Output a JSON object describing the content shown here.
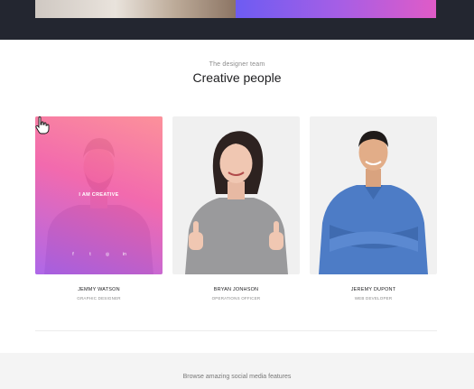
{
  "section": {
    "eyebrow": "The designer team",
    "title": "Creative people"
  },
  "team": [
    {
      "name": "JEMMY WATSON",
      "role": "GRAPHIC DESIGNER"
    },
    {
      "name": "BRYAN JONHSON",
      "role": "OPERATIONS OFFICER"
    },
    {
      "name": "JEREMY DUPONT",
      "role": "WEB DEVELOPER"
    }
  ],
  "hover_card": {
    "label": "I AM CREATIVE",
    "social_icons": [
      "facebook-icon",
      "twitter-icon",
      "instagram-icon",
      "linkedin-icon"
    ],
    "social_glyphs": [
      "f",
      "t",
      "◎",
      "in"
    ]
  },
  "footer": {
    "teaser": "Browse amazing social media features"
  },
  "colors": {
    "dark_band": "#232630",
    "gradient_start": "#ff8c96",
    "gradient_mid": "#f55faa",
    "gradient_end": "#aa5feb"
  }
}
